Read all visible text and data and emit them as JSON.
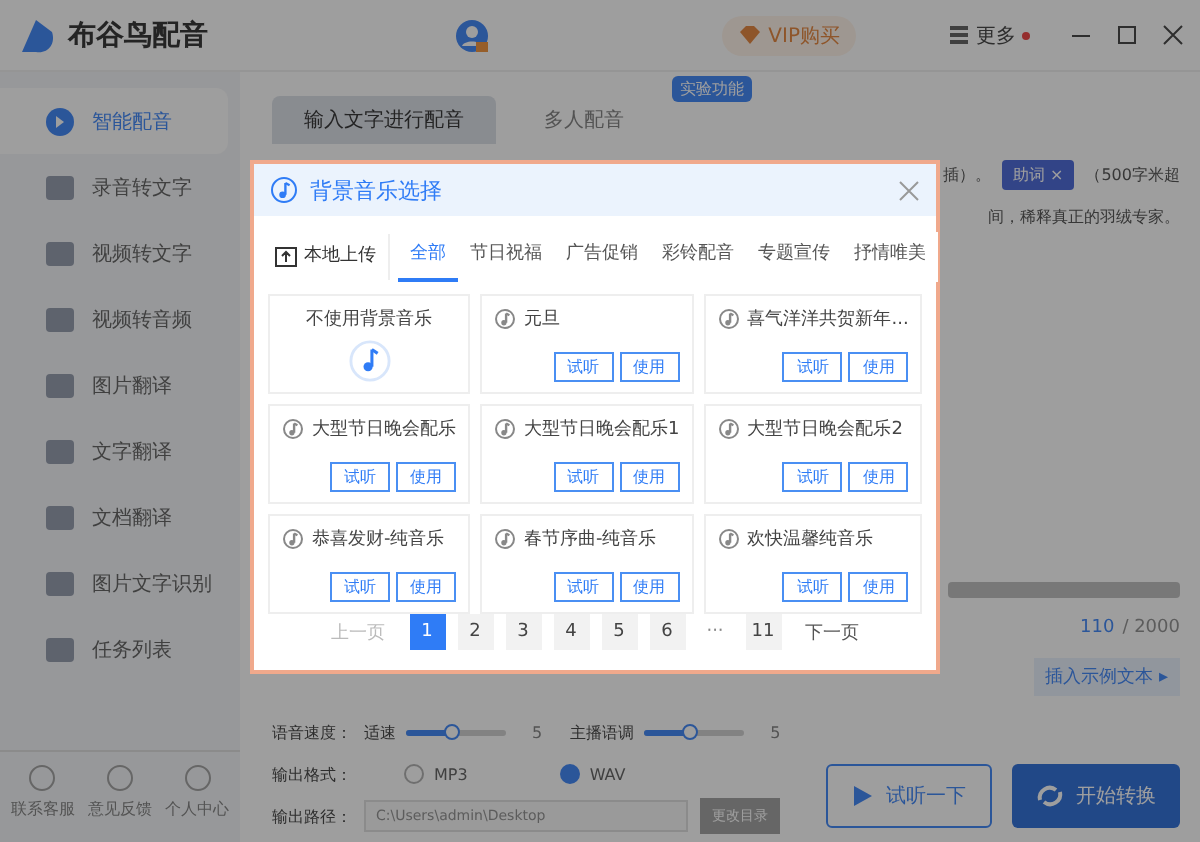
{
  "window": {
    "title": "布谷鸟配音"
  },
  "titlebar": {
    "vip_button": "VIP购买",
    "more_menu": "更多"
  },
  "sidebar": {
    "items": [
      {
        "label": "智能配音",
        "selected": true
      },
      {
        "label": "录音转文字",
        "selected": false
      },
      {
        "label": "视频转文字",
        "selected": false
      },
      {
        "label": "视频转音频",
        "selected": false
      },
      {
        "label": "图片翻译",
        "selected": false
      },
      {
        "label": "文字翻译",
        "selected": false
      },
      {
        "label": "文档翻译",
        "selected": false
      },
      {
        "label": "图片文字识别",
        "selected": false
      },
      {
        "label": "任务列表",
        "selected": false
      }
    ],
    "footer": [
      "联系客服",
      "意见反馈",
      "个人中心"
    ]
  },
  "main": {
    "tabs": [
      {
        "label": "输入文字进行配音",
        "selected": true
      },
      {
        "label": "多人配音",
        "selected": false
      }
    ],
    "tab_badge": "实验功能",
    "hint_line_1": "插）。",
    "hint_chip": "助词 ×",
    "hint_line_1_end": "（500字米超",
    "hint_line_2": "间，稀释真正的羽绒专家。",
    "counter": {
      "count": "110",
      "limit": "/ 2000"
    },
    "example_link": "插入示例文本 ▸",
    "settings": {
      "speed_label": "语音速度：",
      "sliders": [
        {
          "label": "适速",
          "level": 0.45,
          "reading": "5"
        },
        {
          "label": "主播语调",
          "level": 0.45,
          "reading": "5"
        }
      ],
      "format_label": "输出格式：",
      "formats": [
        {
          "label": "MP3",
          "selected": false
        },
        {
          "label": "WAV",
          "selected": true
        }
      ],
      "path_label": "输出路径：",
      "path_value": "C:\\Users\\admin\\Desktop",
      "path_button": "更改目录"
    },
    "actions": {
      "preview": "试听一下",
      "convert": "开始转换"
    }
  },
  "dialog": {
    "title": "背景音乐选择",
    "upload": "本地上传",
    "tabs": [
      {
        "label": "全部",
        "selected": true
      },
      {
        "label": "节日祝福",
        "selected": false
      },
      {
        "label": "广告促销",
        "selected": false
      },
      {
        "label": "彩铃配音",
        "selected": false
      },
      {
        "label": "专题宣传",
        "selected": false
      },
      {
        "label": "抒情唯美",
        "selected": false
      }
    ],
    "tracks": [
      {
        "kind": "none",
        "name": "不使用背景音乐"
      },
      {
        "kind": "track",
        "name": "元旦",
        "preview": "试听",
        "use": "使用"
      },
      {
        "kind": "track",
        "name": "喜气洋洋共贺新年...",
        "preview": "试听",
        "use": "使用"
      },
      {
        "kind": "track",
        "name": "大型节日晚会配乐",
        "preview": "试听",
        "use": "使用"
      },
      {
        "kind": "track",
        "name": "大型节日晚会配乐1",
        "preview": "试听",
        "use": "使用"
      },
      {
        "kind": "track",
        "name": "大型节日晚会配乐2",
        "preview": "试听",
        "use": "使用"
      },
      {
        "kind": "track",
        "name": "恭喜发财-纯音乐",
        "preview": "试听",
        "use": "使用"
      },
      {
        "kind": "track",
        "name": "春节序曲-纯音乐",
        "preview": "试听",
        "use": "使用"
      },
      {
        "kind": "track",
        "name": "欢快温馨纯音乐",
        "preview": "试听",
        "use": "使用"
      }
    ],
    "pagination": {
      "prev": {
        "label": "上一页",
        "disabled": true
      },
      "pages": [
        {
          "kind": "page",
          "label": "1",
          "selected": true
        },
        {
          "kind": "page",
          "label": "2",
          "selected": false
        },
        {
          "kind": "page",
          "label": "3",
          "selected": false
        },
        {
          "kind": "page",
          "label": "4",
          "selected": false
        },
        {
          "kind": "page",
          "label": "5",
          "selected": false
        },
        {
          "kind": "page",
          "label": "6",
          "selected": false
        },
        {
          "kind": "ellipsis",
          "label": "···"
        },
        {
          "kind": "page",
          "label": "11",
          "selected": false
        }
      ],
      "next": "下一页"
    }
  }
}
